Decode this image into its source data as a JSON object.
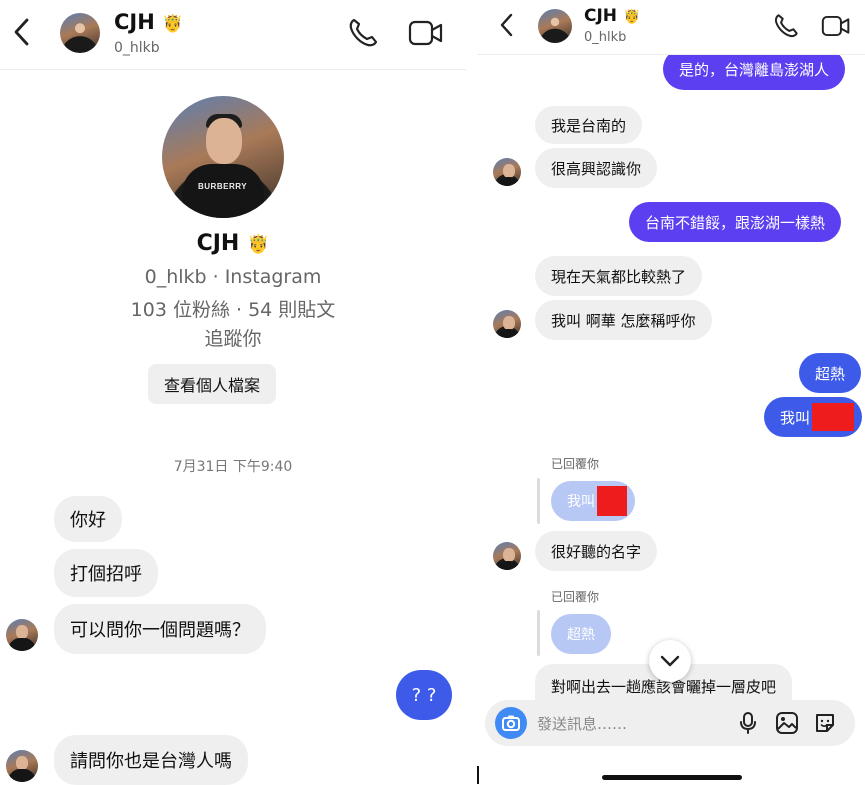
{
  "left": {
    "header": {
      "name": "CJH",
      "crown": "🤴",
      "username": "0_hlkb"
    },
    "profile": {
      "name": "CJH",
      "crown": "🤴",
      "sub1": "0_hlkb · Instagram",
      "sub2": "103 位粉絲 · 54 則貼文",
      "sub3": "追蹤你",
      "view_profile": "查看個人檔案",
      "shirt_brand": "BURBERRY"
    },
    "timestamp": "7月31日 下午9:40",
    "messages": [
      {
        "text": "你好",
        "from": "them"
      },
      {
        "text": "打個招呼",
        "from": "them"
      },
      {
        "text": "可以問你一個問題嗎？",
        "from": "them"
      },
      {
        "text": "? ?",
        "from": "me"
      },
      {
        "text": "請問你也是台灣人嗎",
        "from": "them"
      }
    ]
  },
  "right": {
    "header": {
      "name": "CJH",
      "crown": "🤴",
      "username": "0_hlkb"
    },
    "messages": [
      {
        "text": "是的，台灣離島澎湖人",
        "from": "me"
      },
      {
        "text": "我是台南的",
        "from": "them"
      },
      {
        "text": "很高興認識你",
        "from": "them"
      },
      {
        "text": "台南不錯餒，跟澎湖一樣熱",
        "from": "me"
      },
      {
        "text": "現在天氣都比較熱了",
        "from": "them"
      },
      {
        "text": "我叫 啊華 怎麼稱呼你",
        "from": "them"
      },
      {
        "text": "超熱",
        "from": "me"
      },
      {
        "text": "我叫",
        "from": "me"
      },
      {
        "text": "我叫",
        "from": "me-quoted"
      },
      {
        "text": "很好聽的名字",
        "from": "them"
      },
      {
        "text": "超熱",
        "from": "me-quoted"
      },
      {
        "text": "對啊出去一趟應該會曬掉一層皮吧",
        "from": "them"
      }
    ],
    "replied_label_1": "已回覆你",
    "replied_label_2": "已回覆你",
    "composer_placeholder": "發送訊息……"
  },
  "colors": {
    "my_bubble_purple": "#5b3ff0",
    "my_bubble_blue": "#3d5be8",
    "their_bubble": "#efefef",
    "quoted_bubble": "#b8c8f5",
    "camera_button": "#3f8af5",
    "redaction": "#ee1c1c"
  },
  "icons": [
    "back-chevron-icon",
    "phone-icon",
    "video-camera-icon",
    "camera-icon",
    "microphone-icon",
    "gallery-icon",
    "sticker-icon",
    "chevron-down-icon"
  ]
}
